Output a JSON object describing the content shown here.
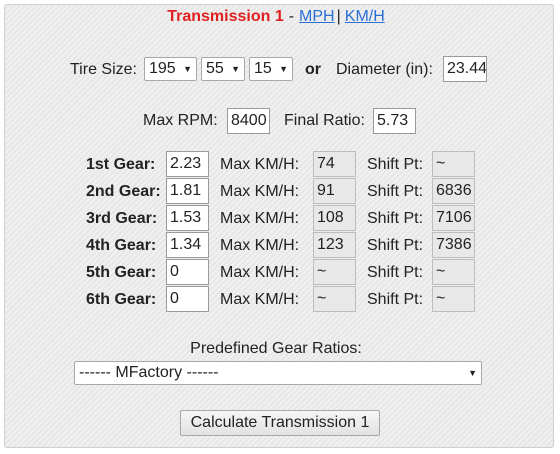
{
  "header": {
    "title": "Transmission 1",
    "separator": "-",
    "mph_link": "MPH",
    "pipe": "|",
    "kmh_link": "KM/H"
  },
  "tire": {
    "label": "Tire Size:",
    "width": "195",
    "aspect": "55",
    "rim": "15",
    "or_label": "or",
    "diameter_label": "Diameter (in):",
    "diameter_value": "23.44"
  },
  "engine": {
    "max_rpm_label": "Max RPM:",
    "max_rpm_value": "8400",
    "final_ratio_label": "Final Ratio:",
    "final_ratio_value": "5.73"
  },
  "gears": [
    {
      "label": "1st Gear:",
      "ratio": "2.23",
      "max_label": "Max KM/H:",
      "max": "74",
      "shift_label": "Shift Pt:",
      "shift": "~"
    },
    {
      "label": "2nd Gear:",
      "ratio": "1.81",
      "max_label": "Max KM/H:",
      "max": "91",
      "shift_label": "Shift Pt:",
      "shift": "6836"
    },
    {
      "label": "3rd Gear:",
      "ratio": "1.53",
      "max_label": "Max KM/H:",
      "max": "108",
      "shift_label": "Shift Pt:",
      "shift": "7106"
    },
    {
      "label": "4th Gear:",
      "ratio": "1.34",
      "max_label": "Max KM/H:",
      "max": "123",
      "shift_label": "Shift Pt:",
      "shift": "7386"
    },
    {
      "label": "5th Gear:",
      "ratio": "0",
      "max_label": "Max KM/H:",
      "max": "~",
      "shift_label": "Shift Pt:",
      "shift": "~"
    },
    {
      "label": "6th Gear:",
      "ratio": "0",
      "max_label": "Max KM/H:",
      "max": "~",
      "shift_label": "Shift Pt:",
      "shift": "~"
    }
  ],
  "predefined": {
    "label": "Predefined Gear Ratios:",
    "selected": "------ MFactory ------"
  },
  "calculate_button": "Calculate Transmission 1",
  "colors": {
    "title": "#e02020",
    "link": "#2a6fd6",
    "panel_bg": "#ececec"
  }
}
